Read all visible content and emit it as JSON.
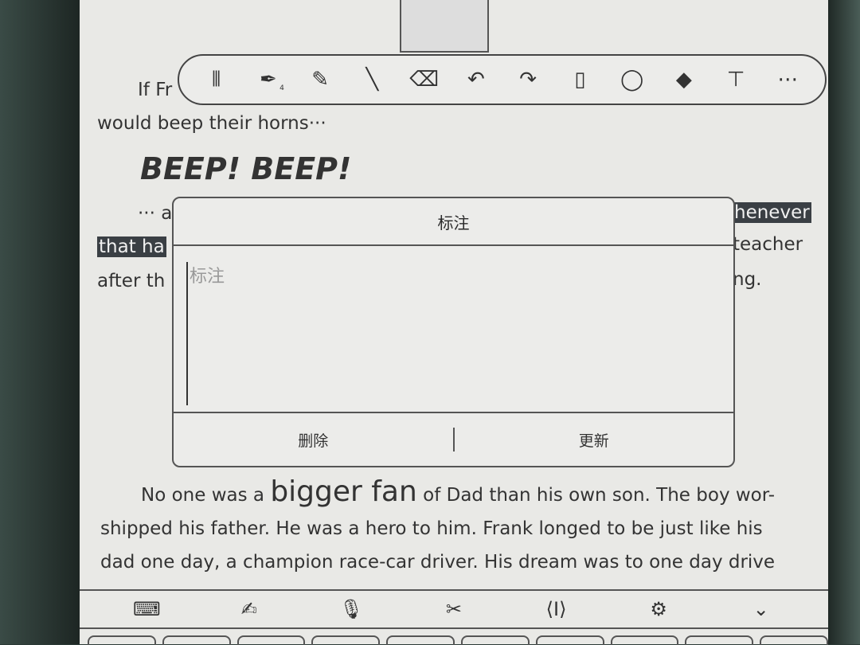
{
  "book": {
    "line1": "If Fr",
    "line2": "would beep their horns···",
    "beep": "BEEP! BEEP!",
    "line3_left": "··· a",
    "line3_right": "henever",
    "line4_left": "that ha",
    "line4_right": "teacher",
    "line5_left": "after th",
    "line5_right": "ng.",
    "para_a": "No one was a ",
    "para_big": "bigger fan",
    "para_b": " of Dad than his own son. The boy wor-",
    "para2": "shipped his father. He was a hero to him. Frank longed to be just like his",
    "para3": "dad one day, a champion race-car driver. His dream was to one day drive"
  },
  "toolbar": {
    "items": [
      {
        "icon": "split-icon",
        "glyph": "⫴"
      },
      {
        "icon": "pen-icon",
        "glyph": "✒",
        "size": "4"
      },
      {
        "icon": "pencil-add-icon",
        "glyph": "✎"
      },
      {
        "icon": "line-icon",
        "glyph": "╲"
      },
      {
        "icon": "eraser-icon",
        "glyph": "⌫"
      },
      {
        "icon": "undo-icon",
        "glyph": "↶"
      },
      {
        "icon": "redo-icon",
        "glyph": "↷"
      },
      {
        "icon": "save-icon",
        "glyph": "▯"
      },
      {
        "icon": "lasso-icon",
        "glyph": "◯"
      },
      {
        "icon": "fill-icon",
        "glyph": "◆"
      },
      {
        "icon": "text-box-icon",
        "glyph": "⊤"
      },
      {
        "icon": "more-icon",
        "glyph": "⋯"
      }
    ]
  },
  "dialog": {
    "title": "标注",
    "placeholder": "标注",
    "delete_label": "删除",
    "update_label": "更新"
  },
  "bottombar": {
    "items": [
      {
        "icon": "keyboard-icon",
        "glyph": "⌨"
      },
      {
        "icon": "handwriting-icon",
        "glyph": "✍"
      },
      {
        "icon": "microphone-icon",
        "glyph": "🎙"
      },
      {
        "icon": "clipboard-cut-icon",
        "glyph": "✂"
      },
      {
        "icon": "cursor-icon",
        "glyph": "⟨I⟩"
      },
      {
        "icon": "settings-icon",
        "glyph": "⚙"
      },
      {
        "icon": "collapse-icon",
        "glyph": "⌄"
      }
    ]
  }
}
